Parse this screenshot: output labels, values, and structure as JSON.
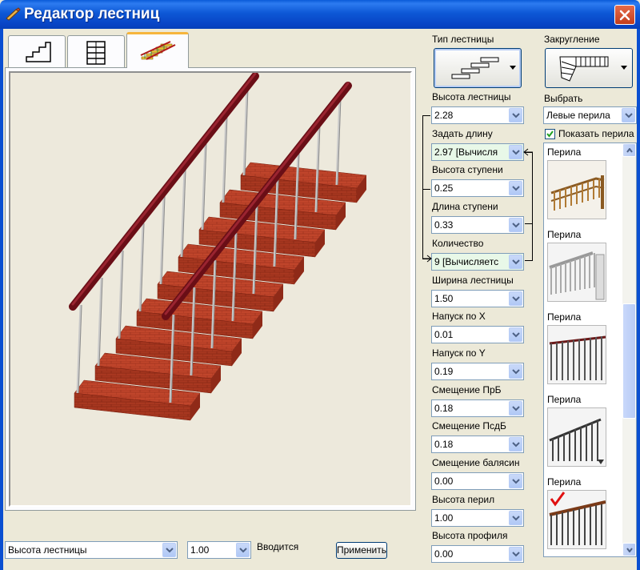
{
  "window": {
    "title": "Редактор лестниц"
  },
  "tabs": [
    {
      "icon": "stairs-profile-icon"
    },
    {
      "icon": "stairs-plan-icon"
    },
    {
      "icon": "stairs-3d-icon",
      "active": true
    }
  ],
  "stair_type": {
    "label": "Тип лестницы"
  },
  "rounding": {
    "label": "Закругление"
  },
  "fields": [
    {
      "label": "Высота лестницы",
      "value": "2.28",
      "computed": false
    },
    {
      "label": "Задать длину",
      "value": "2.97 [Вычисля",
      "computed": true
    },
    {
      "label": "Высота ступени",
      "value": "0.25",
      "computed": false
    },
    {
      "label": "Длина ступени",
      "value": "0.33",
      "computed": false
    },
    {
      "label": "Количество",
      "value": "9 [Вычисляетс",
      "computed": true
    },
    {
      "label": "Ширина лестницы",
      "value": "1.50",
      "computed": false
    },
    {
      "label": "Напуск по X",
      "value": "0.01",
      "computed": false
    },
    {
      "label": "Напуск по Y",
      "value": "0.19",
      "computed": false
    },
    {
      "label": "Смещение ПрБ",
      "value": "0.18",
      "computed": false
    },
    {
      "label": "Смещение ПсдБ",
      "value": "0.18",
      "computed": false
    },
    {
      "label": "Смещение балясин",
      "value": "0.00",
      "computed": false
    },
    {
      "label": "Высота перил",
      "value": "1.00",
      "computed": false
    },
    {
      "label": "Высота профиля",
      "value": "0.00",
      "computed": false
    }
  ],
  "select": {
    "label": "Выбрать",
    "value": "Левые перила"
  },
  "show_railing": {
    "label": "Показать перила",
    "checked": true
  },
  "railings": [
    {
      "label": "Перила",
      "style": "wood",
      "selected": false
    },
    {
      "label": "Перила",
      "style": "white-balusters",
      "selected": false
    },
    {
      "label": "Перила",
      "style": "dark-balusters",
      "selected": false
    },
    {
      "label": "Перила",
      "style": "metal",
      "selected": false
    },
    {
      "label": "Перила",
      "style": "iron",
      "selected": true
    }
  ],
  "bottom": {
    "param": "Высота лестницы",
    "value": "1.00",
    "mode": "Вводится",
    "apply": "Применить"
  },
  "colors": {
    "accent": "#f6b53c",
    "title_bar": "#0a5bd8",
    "brick": "#c0452b",
    "handrail": "#7a1018",
    "computed_field": "#e8f8e8"
  }
}
